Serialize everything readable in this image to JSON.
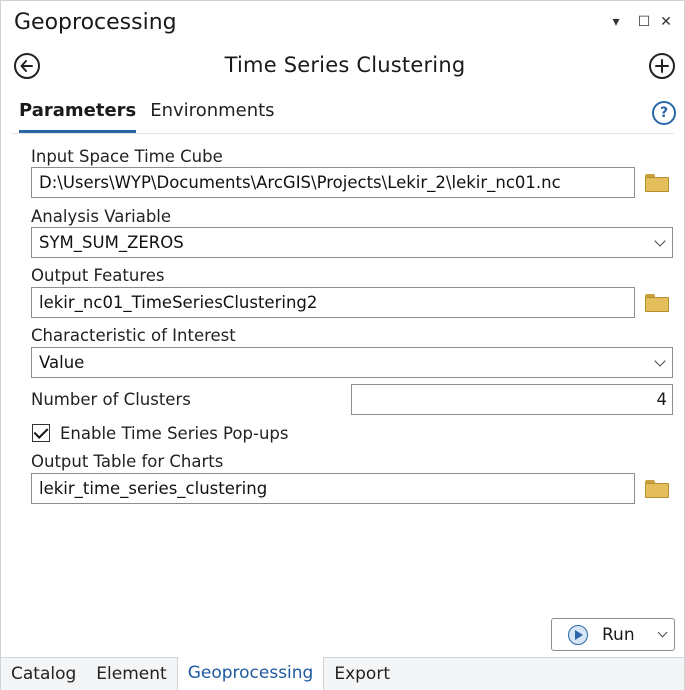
{
  "pane": {
    "title": "Geoprocessing",
    "controls": {
      "menu": "▾",
      "maximize": "☐",
      "close": "✕"
    }
  },
  "tool": {
    "title": "Time Series Clustering",
    "back_icon": "arrow-left-icon",
    "add_icon": "plus-icon"
  },
  "tabs": [
    {
      "label": "Parameters",
      "active": true
    },
    {
      "label": "Environments",
      "active": false
    }
  ],
  "help_label": "?",
  "params": {
    "input_cube": {
      "label": "Input Space Time Cube",
      "value": "D:\\Users\\WYP\\Documents\\ArcGIS\\Projects\\Lekir_2\\lekir_nc01.nc"
    },
    "analysis_variable": {
      "label": "Analysis Variable",
      "value": "SYM_SUM_ZEROS"
    },
    "output_features": {
      "label": "Output Features",
      "value": "lekir_nc01_TimeSeriesClustering2"
    },
    "characteristic": {
      "label": "Characteristic of Interest",
      "value": "Value"
    },
    "num_clusters": {
      "label": "Number of Clusters",
      "value": "4"
    },
    "enable_popups": {
      "label": "Enable Time Series Pop-ups",
      "checked": true
    },
    "output_table": {
      "label": "Output Table for Charts",
      "value": "lekir_time_series_clustering"
    }
  },
  "run": {
    "label": "Run"
  },
  "bottom_tabs": [
    {
      "label": "Catalog",
      "active": false
    },
    {
      "label": "Element",
      "active": false
    },
    {
      "label": "Geoprocessing",
      "active": true
    },
    {
      "label": "Export",
      "active": false
    }
  ],
  "colors": {
    "accent": "#2b67a8",
    "folder": "#e4be5a",
    "active_tab_text": "#1f5aa0"
  }
}
